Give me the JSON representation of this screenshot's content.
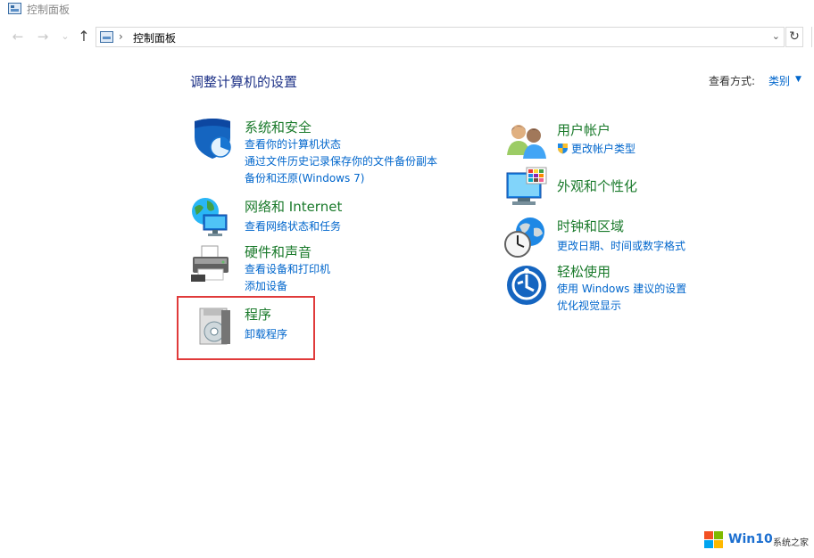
{
  "window": {
    "title": "控制面板"
  },
  "navigation": {
    "back": "←",
    "forward": "→",
    "recent": "⌄",
    "up": "↑",
    "address_separator": "›",
    "address_path": "控制面板",
    "address_dropdown": "⌄",
    "refresh": "↻"
  },
  "main": {
    "heading": "调整计算机的设置",
    "view_by_label": "查看方式:",
    "view_by_value": "类别",
    "view_by_arrow": "▼"
  },
  "categories_left": [
    {
      "title": "系统和安全",
      "icon": "shield-icon",
      "links": [
        "查看你的计算机状态",
        "通过文件历史记录保存你的文件备份副本",
        "备份和还原(Windows 7)"
      ]
    },
    {
      "title": "网络和 Internet",
      "icon": "network-globe-icon",
      "links": [
        "查看网络状态和任务"
      ]
    },
    {
      "title": "硬件和声音",
      "icon": "printer-icon",
      "links": [
        "查看设备和打印机",
        "添加设备"
      ]
    },
    {
      "title": "程序",
      "icon": "programs-disc-icon",
      "links": [
        "卸载程序"
      ]
    }
  ],
  "categories_right": [
    {
      "title": "用户帐户",
      "icon": "users-icon",
      "links": [
        "更改帐户类型"
      ]
    },
    {
      "title": "外观和个性化",
      "icon": "monitor-palette-icon",
      "links": []
    },
    {
      "title": "时钟和区域",
      "icon": "clock-globe-icon",
      "links": [
        "更改日期、时间或数字格式"
      ]
    },
    {
      "title": "轻松使用",
      "icon": "ease-of-access-icon",
      "links": [
        "使用 Windows 建议的设置",
        "优化视觉显示"
      ]
    }
  ],
  "watermark": {
    "brand": "Win10",
    "site": "系统之家"
  },
  "colors": {
    "category_title": "#1a7a2b",
    "link": "#0066cc",
    "heading": "#1e3287",
    "highlight_box": "#e03a3a"
  }
}
